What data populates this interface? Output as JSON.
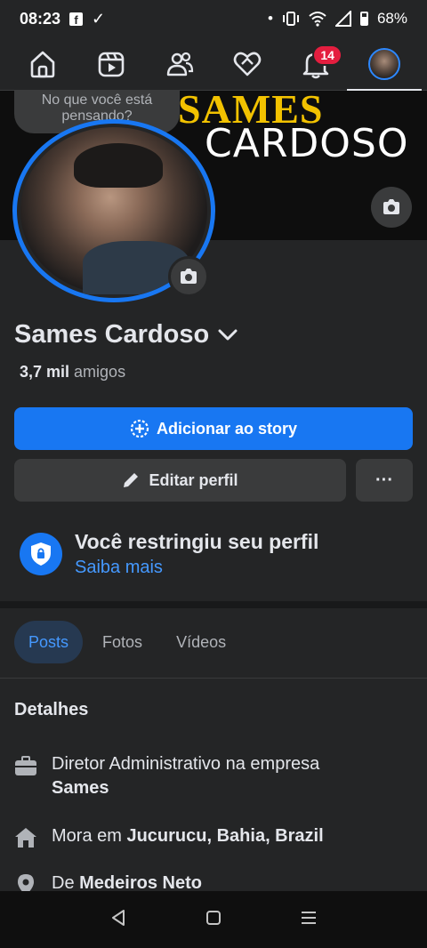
{
  "status_bar": {
    "time": "08:23",
    "fb_glyph": "f",
    "check_glyph": "✓",
    "dot_glyph": "•",
    "battery": "68%"
  },
  "nav": {
    "notifications_badge": "14"
  },
  "cover": {
    "line1": "SAMES",
    "line2": "CARDOSO"
  },
  "story_prompt": {
    "line1": "No que você está",
    "line2": "pensando?"
  },
  "profile": {
    "name": "Sames Cardoso",
    "friends_count": "3,7 mil",
    "friends_label": "amigos"
  },
  "buttons": {
    "add_story": "Adicionar ao story",
    "edit_profile": "Editar perfil",
    "more": "···"
  },
  "restriction": {
    "title": "Você restringiu seu perfil",
    "link": "Saiba mais"
  },
  "tabs": [
    {
      "label": "Posts"
    },
    {
      "label": "Fotos"
    },
    {
      "label": "Vídeos"
    }
  ],
  "details": {
    "title": "Detalhes",
    "work_prefix": "Diretor Administrativo na empresa",
    "work_company": "Sames",
    "lives_prefix": "Mora em",
    "lives_place": "Jucurucu, Bahia, Brazil",
    "from_prefix": "De",
    "from_place": "Medeiros Neto"
  },
  "colors": {
    "accent": "#1877f2",
    "link": "#4599ff",
    "badge": "#e41e3f",
    "background": "#242526"
  }
}
